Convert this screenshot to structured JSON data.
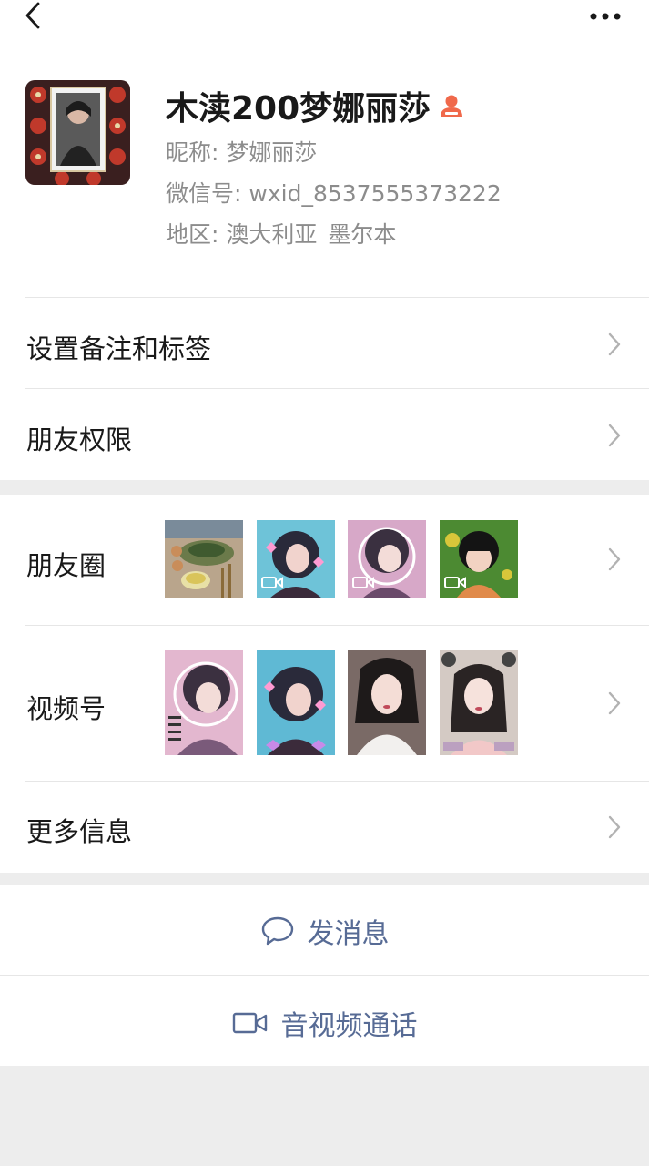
{
  "profile": {
    "name": "木渎200梦娜丽莎",
    "nickname_label": "昵称:",
    "nickname": "梦娜丽莎",
    "wechat_id_label": "微信号:",
    "wechat_id": "wxid_8537555373222",
    "region_label": "地区:",
    "region_country": "澳大利亚",
    "region_city": "墨尔本"
  },
  "menu": {
    "remarks_tags": "设置备注和标签",
    "friend_permissions": "朋友权限",
    "moments": "朋友圈",
    "channels": "视频号",
    "more_info": "更多信息"
  },
  "actions": {
    "send_message": "发消息",
    "video_call": "音视频通话"
  },
  "icons": {
    "back": "back-arrow-icon",
    "more": "more-dots-icon",
    "badge": "person-badge-icon",
    "chevron": "chevron-right-icon",
    "message": "chat-bubble-icon",
    "video": "video-camera-icon"
  },
  "colors": {
    "link_blue": "#576b95",
    "badge_orange": "#f0694b",
    "secondary_text": "#8c8c8c",
    "background": "#ededed"
  }
}
